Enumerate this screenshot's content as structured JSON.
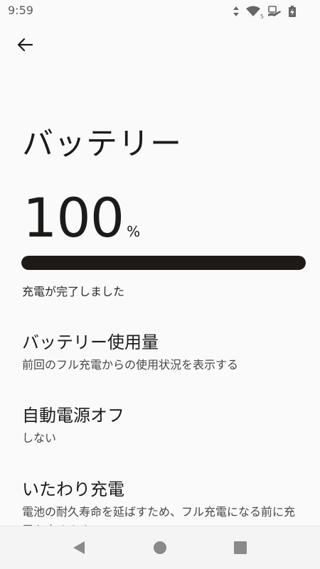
{
  "status_bar": {
    "time": "9:59",
    "network_badge": "5"
  },
  "header": {
    "back_icon": "arrow-back-icon"
  },
  "page": {
    "title": "バッテリー"
  },
  "battery": {
    "level_value": "100",
    "level_unit": "%",
    "level_fraction": 1.0,
    "status_text": "充電が完了しました",
    "bar_color": "#1f1a17"
  },
  "settings": [
    {
      "title": "バッテリー使用量",
      "summary": "前回のフル充電からの使用状況を表示する"
    },
    {
      "title": "自動電源オフ",
      "summary": "しない"
    },
    {
      "title": "いたわり充電",
      "summary": "電池の耐久寿命を延ばすため、フル充電になる前に充電を止めます"
    }
  ],
  "nav": {
    "back": "nav-back-icon",
    "home": "nav-home-icon",
    "recents": "nav-recents-icon"
  }
}
